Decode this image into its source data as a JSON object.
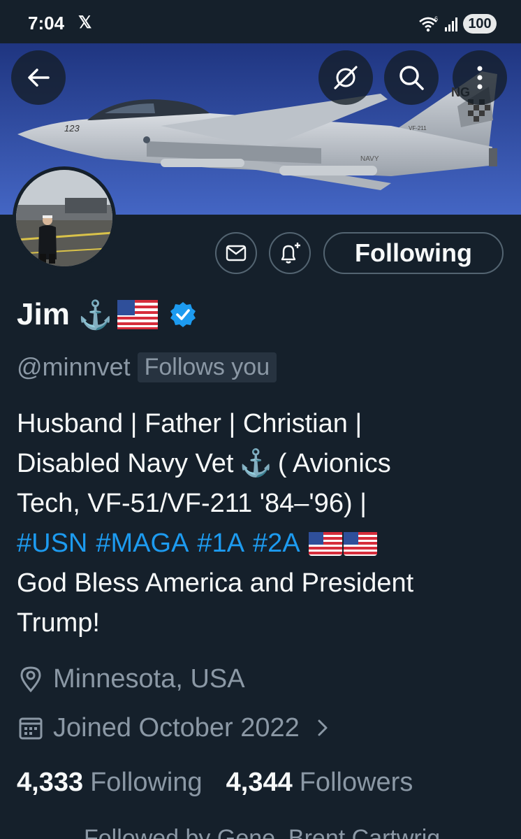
{
  "status_bar": {
    "time": "7:04",
    "app_glyph": "𝕏",
    "battery": "100",
    "icons": [
      "wifi-icon",
      "signal-icon"
    ]
  },
  "header": {
    "buttons": [
      "back-arrow-icon",
      "grok-icon",
      "search-icon",
      "more-vertical-icon"
    ]
  },
  "banner": {
    "jet_markings": [
      "123",
      "NG",
      "VF-211",
      "NAVY"
    ]
  },
  "profile_actions": {
    "following_label": "Following",
    "icons": [
      "mail-icon",
      "bell-plus-icon"
    ]
  },
  "profile": {
    "name": "Jim",
    "name_emoji": "⚓",
    "handle": "@minnvet",
    "follows_you": "Follows you",
    "verified": true
  },
  "bio": {
    "line1": "Husband | Father | Christian |",
    "line2a": "Disabled Navy Vet",
    "line2_anchor": "⚓",
    "line2b": "( Avionics",
    "line3": "Tech, VF-51/VF-211 '84–'96) |",
    "tags": [
      "#USN",
      "#MAGA",
      "#1A",
      "#2A"
    ],
    "line5": "God Bless America and President",
    "line6": "Trump!"
  },
  "meta": {
    "location": "Minnesota, USA",
    "joined": "Joined October 2022"
  },
  "stats": {
    "following_count": "4,333",
    "following_label": "Following",
    "followers_count": "4,344",
    "followers_label": "Followers"
  },
  "followed_by": "Followed by Gene, Brent Cartwrig...",
  "colors": {
    "background": "#15202b",
    "accent": "#1d9bf0",
    "muted": "#8b98a5",
    "border": "#536471"
  }
}
